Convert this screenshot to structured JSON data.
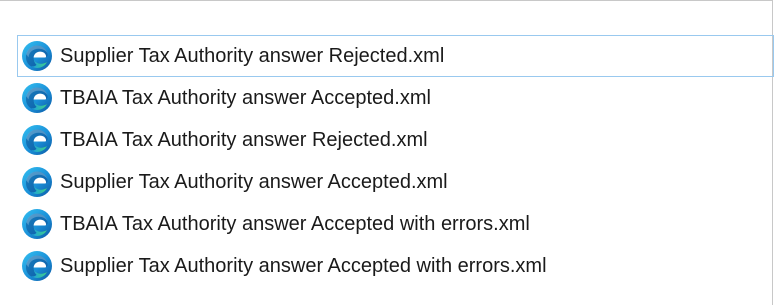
{
  "files": [
    {
      "name": "Supplier Tax Authority answer Rejected.xml",
      "icon": "edge-browser-icon",
      "focused": true
    },
    {
      "name": "TBAIA Tax Authority answer Accepted.xml",
      "icon": "edge-browser-icon",
      "focused": false
    },
    {
      "name": "TBAIA Tax Authority answer Rejected.xml",
      "icon": "edge-browser-icon",
      "focused": false
    },
    {
      "name": "Supplier Tax Authority answer Accepted.xml",
      "icon": "edge-browser-icon",
      "focused": false
    },
    {
      "name": "TBAIA Tax Authority answer Accepted with errors.xml",
      "icon": "edge-browser-icon",
      "focused": false
    },
    {
      "name": "Supplier Tax Authority answer Accepted with errors.xml",
      "icon": "edge-browser-icon",
      "focused": false
    }
  ],
  "colors": {
    "focus_border": "#99c9ef",
    "panel_border": "#c8c8c8",
    "text": "#1a1a1a"
  }
}
